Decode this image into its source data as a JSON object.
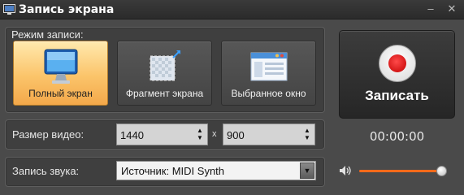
{
  "window": {
    "title": "Запись экрана",
    "minimize_glyph": "–",
    "close_glyph": "✕"
  },
  "mode": {
    "label": "Режим записи:",
    "items": [
      {
        "label": "Полный экран",
        "icon": "monitor-icon",
        "selected": true
      },
      {
        "label": "Фрагмент экрана",
        "icon": "screen-fragment-icon",
        "selected": false
      },
      {
        "label": "Выбранное окно",
        "icon": "window-icon",
        "selected": false
      }
    ]
  },
  "record": {
    "label": "Записать",
    "timer": "00:00:00"
  },
  "video_size": {
    "label": "Размер видео:",
    "width": "1440",
    "height": "900",
    "separator": "x"
  },
  "audio": {
    "label": "Запись звука:",
    "source": "Источник: MIDI Synth",
    "volume": 1.0
  },
  "colors": {
    "accent_orange": "#f3a84a",
    "record_red": "#d80000",
    "slider_fill": "#ff6a1a"
  }
}
